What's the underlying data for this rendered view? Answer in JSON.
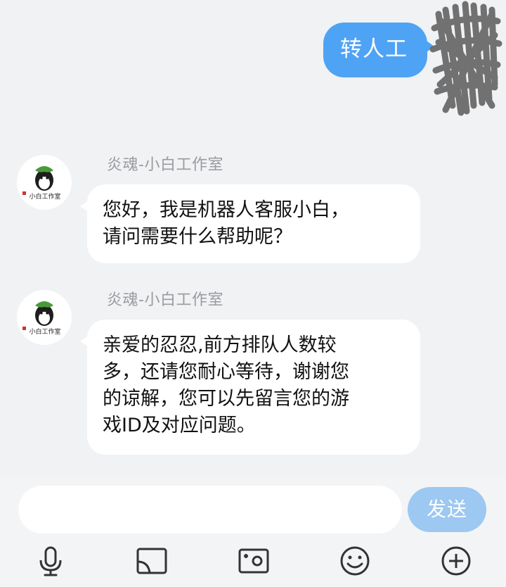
{
  "outgoing": {
    "text": "转人工"
  },
  "messages": [
    {
      "sender": "炎魂-小白工作室",
      "lines": [
        "您好，我是机器人客服小白，",
        "请问需要什么帮助呢？"
      ],
      "avatar_label": "小白工作室"
    },
    {
      "sender": "炎魂-小白工作室",
      "lines": [
        "亲爱的忍忍,前方排队人数较",
        "多，还请您耐心等待，谢谢您",
        "的谅解，您可以先留言您的游",
        "戏ID及对应问题。"
      ],
      "avatar_label": "小白工作室"
    }
  ],
  "input": {
    "value": "",
    "placeholder": ""
  },
  "send_label": "发送",
  "toolbar": [
    "microphone-icon",
    "screen-cast-icon",
    "photo-icon",
    "emoji-icon",
    "plus-icon"
  ],
  "colors": {
    "background": "#f1f2f4",
    "outgoing_bubble": "#4fa3f5",
    "send_button": "#9cc8f1",
    "sender_text": "#9a9aa0"
  }
}
